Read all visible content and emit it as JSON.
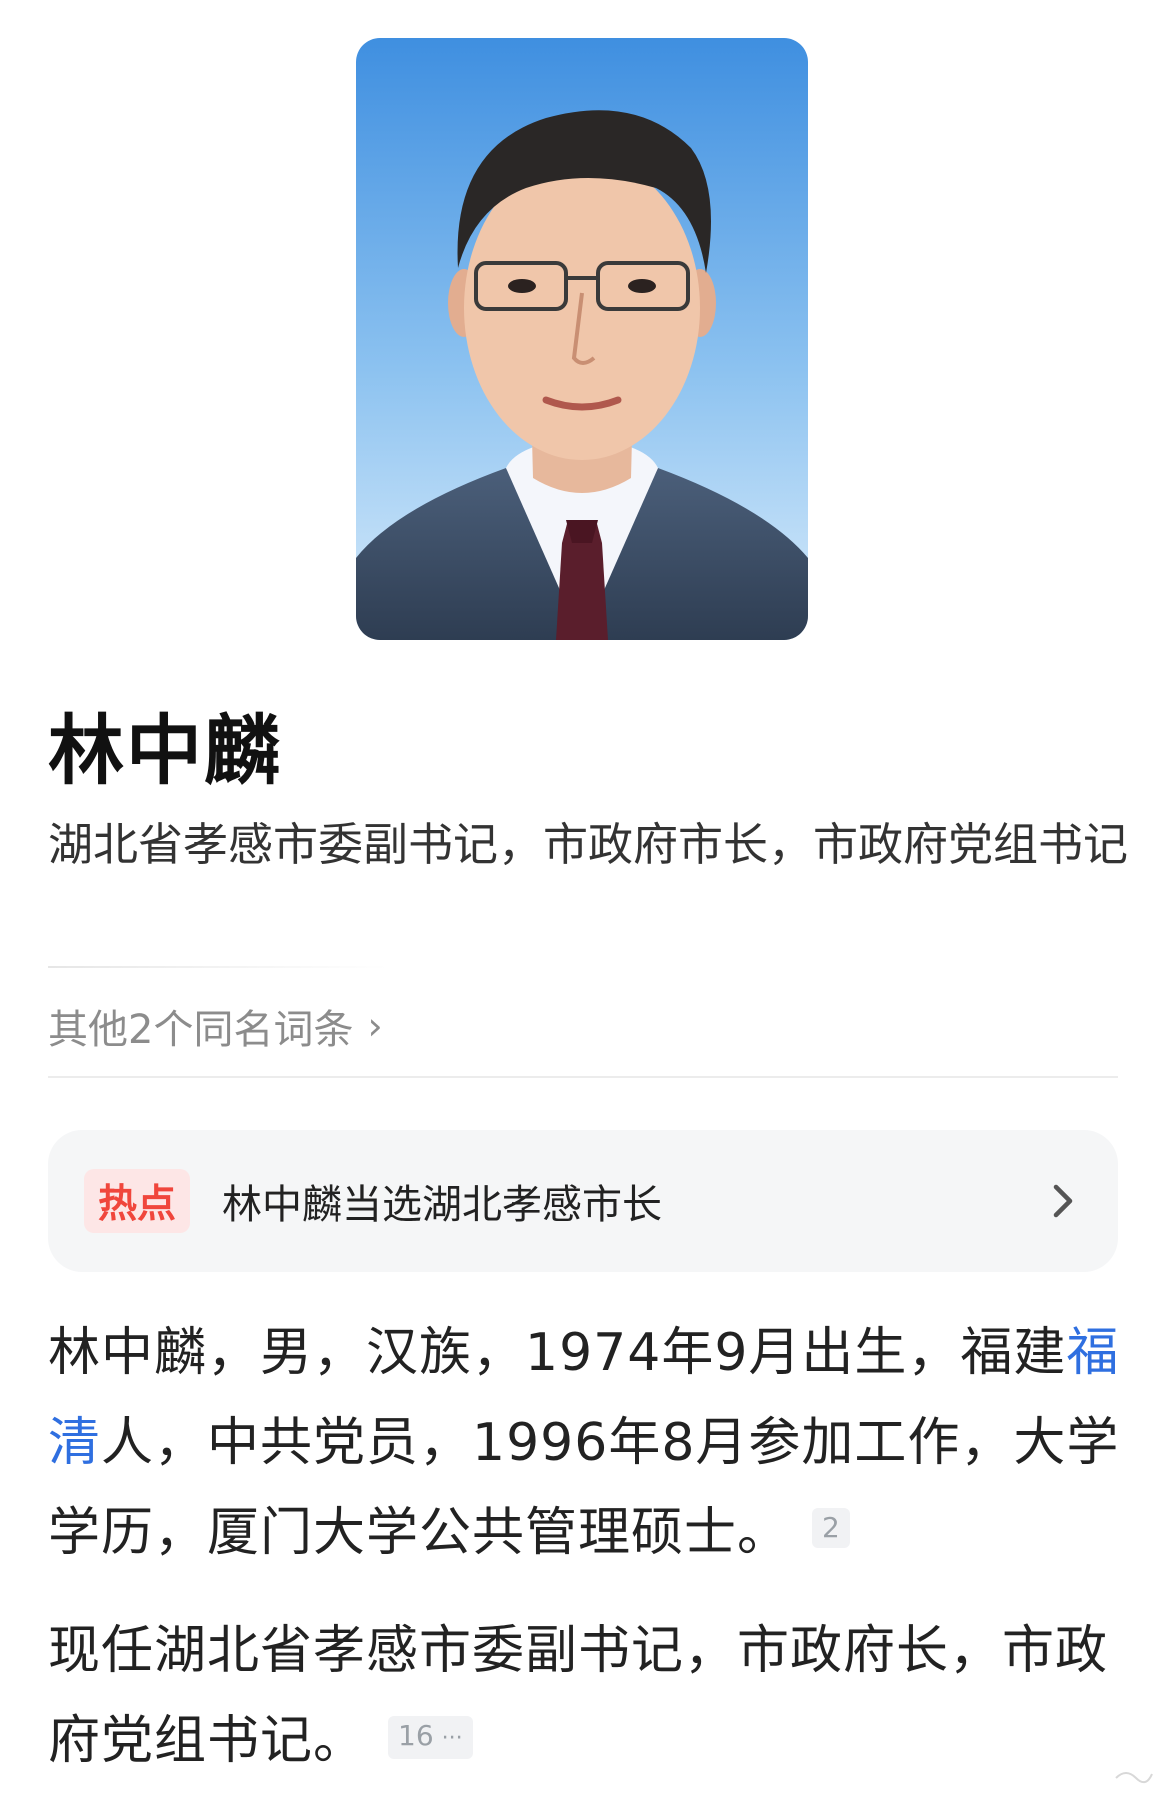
{
  "profile": {
    "name": "林中麟",
    "subtitle": "湖北省孝感市委副书记，市政府市长，市政府党组书记",
    "others_link": "其他2个同名词条",
    "hot": {
      "badge": "热点",
      "text": "林中麟当选湖北孝感市长"
    }
  },
  "paragraph1": {
    "before_link": "林中麟，男，汉族，1974年9月出生，福建",
    "link": "福清",
    "after_link": "人，中共党员，1996年8月参加工作，大学学历，厦门大学公共管理硕士。",
    "citation": "2"
  },
  "paragraph2": {
    "text": "现任湖北省孝感市委副书记，市政府长，市政府党组书记。",
    "citation": "16",
    "citation_more": "···"
  },
  "colors": {
    "link": "#2f6fe0",
    "hot_badge_text": "#f0463c",
    "hot_badge_bg": "#fde6e6",
    "photo_background_top": "#3f8fe0",
    "photo_background_bottom": "#d9ecfb"
  },
  "icons": {
    "others_chevron": "chevron-right-icon",
    "hot_chevron": "chevron-right-icon"
  }
}
